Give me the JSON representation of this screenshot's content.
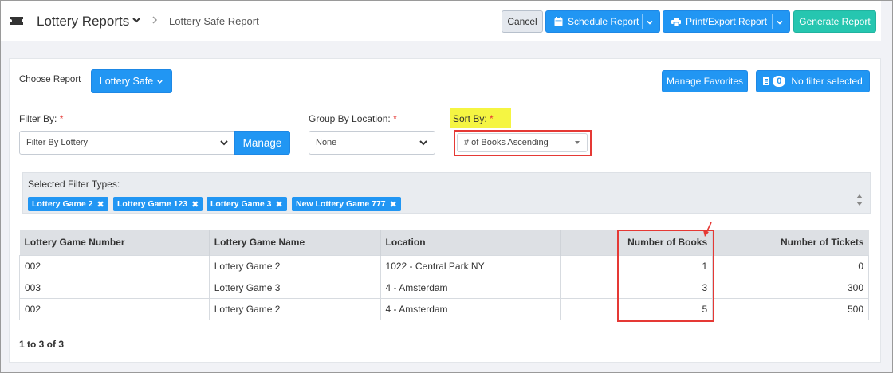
{
  "header": {
    "title": "Lottery Reports",
    "breadcrumb": "Lottery Safe Report",
    "cancel_label": "Cancel",
    "schedule_label": "Schedule Report",
    "print_label": "Print/Export Report",
    "generate_label": "Generate Report"
  },
  "panel": {
    "choose_report_label": "Choose Report",
    "report_selector": "Lottery Safe",
    "manage_favorites_label": "Manage Favorites",
    "filter_count": "0",
    "filter_status": "No filter selected"
  },
  "filters": {
    "filter_by_label": "Filter By:",
    "filter_by_value": "Filter By Lottery",
    "manage_label": "Manage",
    "group_by_label": "Group By Location:",
    "group_by_value": "None",
    "sort_by_label": "Sort By:",
    "sort_by_value": "# of Books Ascending",
    "required_mark": "*"
  },
  "selected_filters": {
    "title": "Selected Filter Types:",
    "chips": [
      "Lottery Game 2",
      "Lottery Game 123",
      "Lottery Game 3",
      "New Lottery Game 777"
    ]
  },
  "table": {
    "columns": [
      "Lottery Game Number",
      "Lottery Game Name",
      "Location",
      "Number of Books",
      "Number of Tickets"
    ],
    "rows": [
      [
        "002",
        "Lottery Game 2",
        "1022 - Central Park NY",
        "1",
        "0"
      ],
      [
        "003",
        "Lottery Game 3",
        "4 - Amsterdam",
        "3",
        "300"
      ],
      [
        "002",
        "Lottery Game 2",
        "4 - Amsterdam",
        "5",
        "500"
      ]
    ]
  },
  "pagination": {
    "summary": "1 to 3 of 3"
  },
  "colors": {
    "primary": "#2196f3",
    "accent": "#26c6b0",
    "annotation": "#e53935",
    "highlight": "#f5f542"
  },
  "icons": [
    "ticket-icon",
    "chevron-down-icon",
    "chevron-right-icon",
    "calendar-icon",
    "printer-icon",
    "list-icon",
    "close-icon",
    "sort-arrows-icon"
  ]
}
